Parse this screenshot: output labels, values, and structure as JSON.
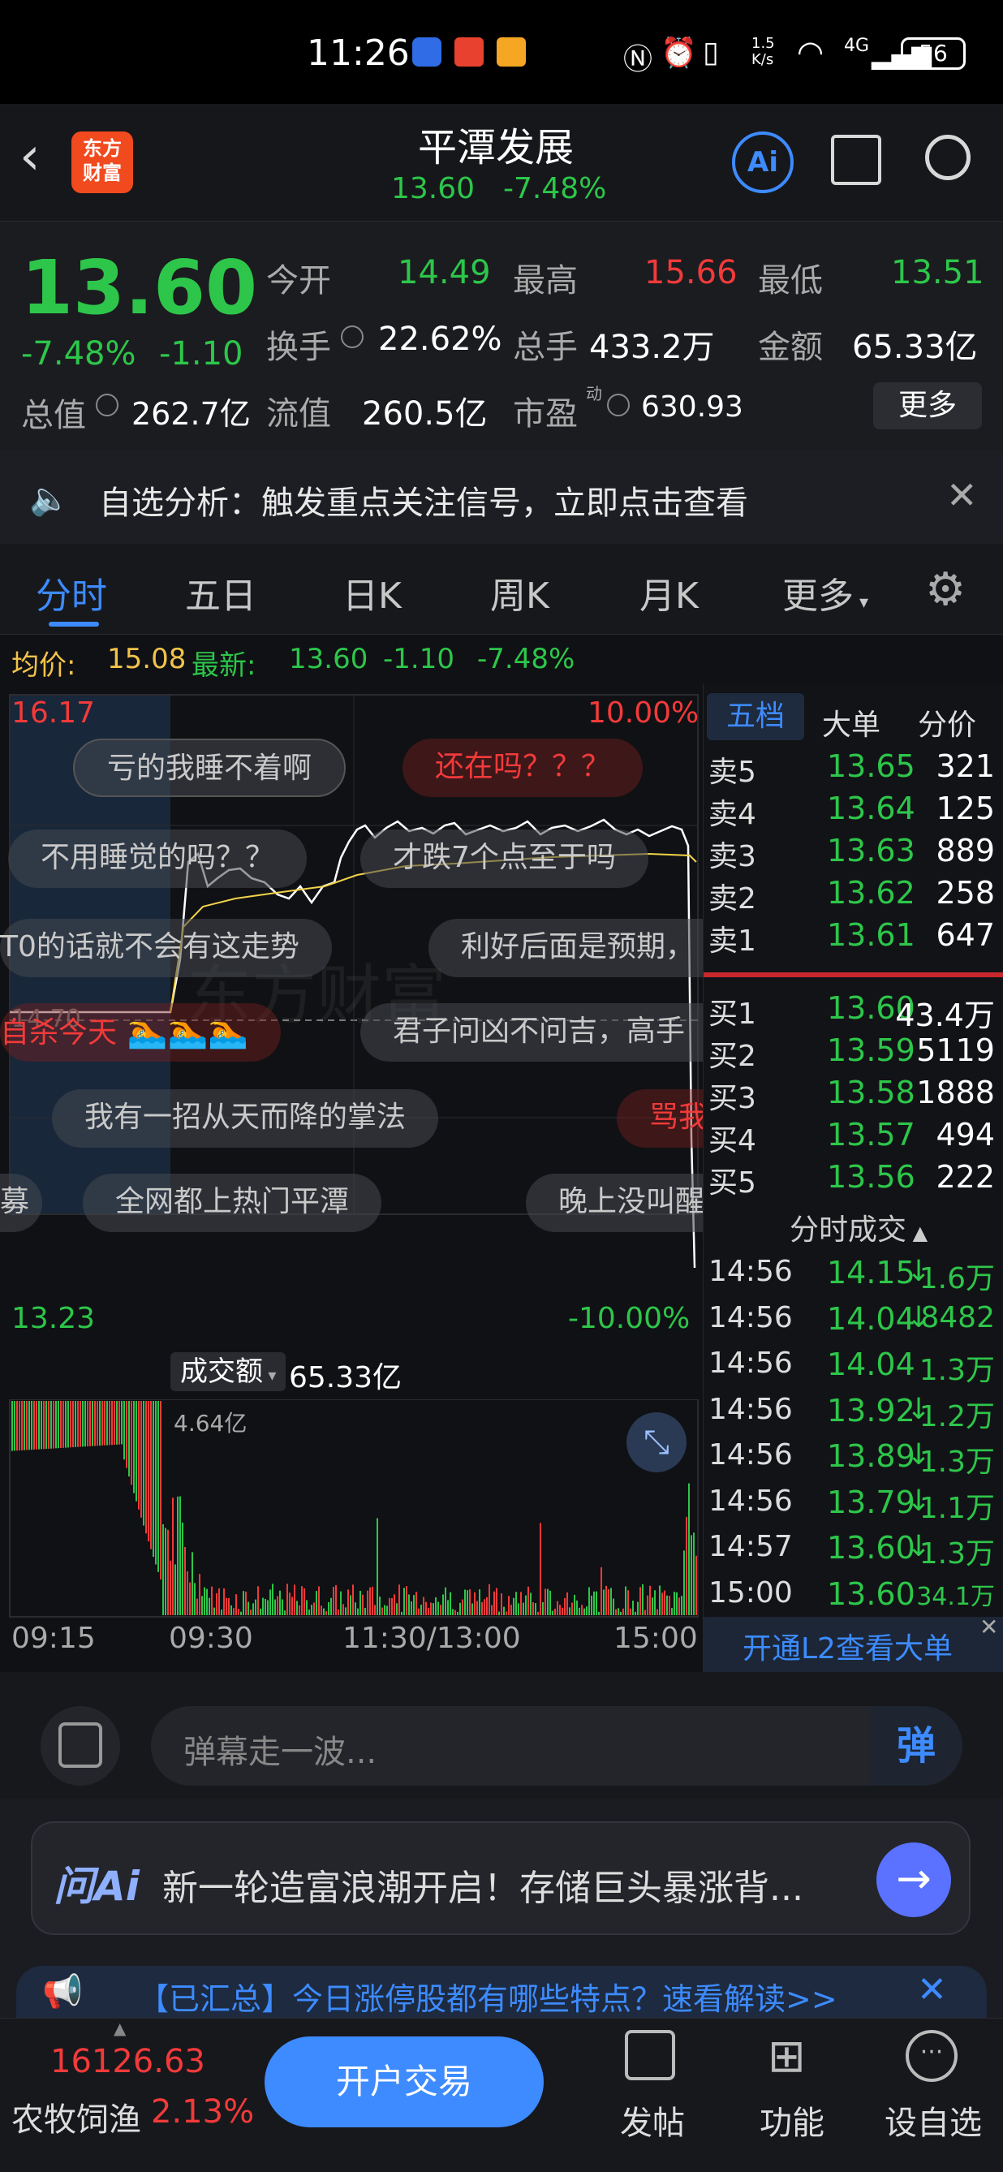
{
  "status": {
    "time": "11:26",
    "speed": "1.5\nK/s",
    "net": "4G",
    "battery": "56"
  },
  "header": {
    "title": "平潭发展",
    "price": "13.60",
    "change": "-7.48%",
    "logo_line1": "东方",
    "logo_line2": "财富",
    "ai": "Ai"
  },
  "quote": {
    "price": "13.60",
    "pct": "-7.48%",
    "chg": "-1.10",
    "open_label": "今开",
    "open": "14.49",
    "high_label": "最高",
    "high": "15.66",
    "low_label": "最低",
    "low": "13.51",
    "turnover_label": "换手",
    "turnover": "22.62%",
    "vol_label": "总手",
    "vol": "433.2万",
    "amt_label": "金额",
    "amt": "65.33亿",
    "mcap_label": "总值",
    "mcap": "262.7亿",
    "float_label": "流值",
    "float": "260.5亿",
    "pe_label": "市盈",
    "pe_sup": "动",
    "pe": "630.93",
    "more": "更多"
  },
  "notice": {
    "text": "自选分析：触发重点关注信号，立即点击查看"
  },
  "tabs": [
    "分时",
    "五日",
    "日K",
    "周K",
    "月K",
    "更多"
  ],
  "pricebar": {
    "avg_label": "均价:",
    "avg": "15.08",
    "latest_label": "最新:",
    "latest": "13.60",
    "chg": "-1.10",
    "pct": "-7.48%"
  },
  "chart": {
    "top_price": "16.17",
    "top_pct": "10.00%",
    "bottom_price": "13.23",
    "bottom_pct": "-10.00%",
    "mid_price": "14.70",
    "vol_label": "成交额",
    "vol_total": "65.33亿",
    "vol_max": "4.64亿",
    "times": [
      "09:15",
      "09:30",
      "11:30/13:00",
      "15:00"
    ],
    "watermark": "东方财富"
  },
  "danmu": [
    "亏的我睡不着啊",
    "还在吗？？？",
    "不用睡觉的吗？？",
    "才跌7个点至于吗",
    "T0的话就不会有这走势",
    "利好后面是预期，",
    "自杀今天",
    "君子问凶不问吉，高手",
    "我有一招从天而降的掌法",
    "骂我",
    "全网都上热门平潭",
    "晚上没叫醒",
    "募"
  ],
  "side": {
    "tabs": [
      "五档",
      "大单",
      "分价"
    ],
    "asks": [
      {
        "l": "卖5",
        "p": "13.65",
        "v": "321"
      },
      {
        "l": "卖4",
        "p": "13.64",
        "v": "125"
      },
      {
        "l": "卖3",
        "p": "13.63",
        "v": "889"
      },
      {
        "l": "卖2",
        "p": "13.62",
        "v": "258"
      },
      {
        "l": "卖1",
        "p": "13.61",
        "v": "647"
      }
    ],
    "bids": [
      {
        "l": "买1",
        "p": "13.60",
        "v": "43.4万"
      },
      {
        "l": "买2",
        "p": "13.59",
        "v": "5119"
      },
      {
        "l": "买3",
        "p": "13.58",
        "v": "1888"
      },
      {
        "l": "买4",
        "p": "13.57",
        "v": "494"
      },
      {
        "l": "买5",
        "p": "13.56",
        "v": "222"
      }
    ],
    "trades_title": "分时成交",
    "trades": [
      {
        "t": "14:56",
        "p": "14.15",
        "d": "↓",
        "v": "1.6万"
      },
      {
        "t": "14:56",
        "p": "14.04",
        "d": "↓",
        "v": "8482"
      },
      {
        "t": "14:56",
        "p": "14.04",
        "d": "",
        "v": "1.3万"
      },
      {
        "t": "14:56",
        "p": "13.92",
        "d": "↓",
        "v": "1.2万"
      },
      {
        "t": "14:56",
        "p": "13.89",
        "d": "↓",
        "v": "1.3万"
      },
      {
        "t": "14:56",
        "p": "13.79",
        "d": "↓",
        "v": "1.1万"
      },
      {
        "t": "14:57",
        "p": "13.60",
        "d": "↓",
        "v": "1.3万"
      },
      {
        "t": "15:00",
        "p": "13.60",
        "d": "",
        "v": "34.1万"
      }
    ],
    "l2": "开通L2查看大单"
  },
  "input": {
    "placeholder": "弹幕走一波...",
    "send": "弹"
  },
  "ai_banner": {
    "logo": "问Ai",
    "text": "新一轮造富浪潮开启！存储巨头暴涨背..."
  },
  "news": {
    "text": "【已汇总】今日涨停股都有哪些特点？速看解读>>"
  },
  "bottom": {
    "index_value": "16126.63",
    "index_name": "农牧饲渔",
    "index_pct": "2.13%",
    "trade": "开户交易",
    "post": "发帖",
    "func": "功能",
    "fav": "设自选"
  },
  "colors": {
    "up": "#f23a3a",
    "down": "#2dc64a",
    "accent": "#3d8bff",
    "avg_line": "#f2d34a"
  }
}
